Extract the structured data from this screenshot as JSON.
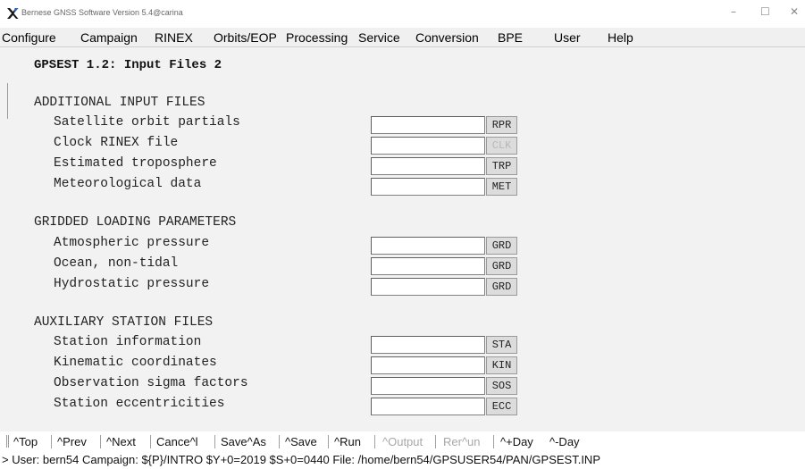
{
  "window": {
    "title": "Bernese GNSS Software Version 5.4@carina",
    "controls": {
      "minimize": "–",
      "maximize": "☐",
      "close": "✕"
    },
    "icon": "bernese-x-icon"
  },
  "menu": [
    "Configure",
    "Campaign",
    "RINEX",
    "Orbits/EOP",
    "Processing",
    "Service",
    "Conversion",
    "BPE",
    "User",
    "Help"
  ],
  "panel": {
    "title": "GPSEST 1.2: Input Files 2",
    "sections": [
      {
        "heading": "ADDITIONAL INPUT FILES",
        "rows": [
          {
            "label": "Satellite orbit partials",
            "value": "",
            "button": "RPR",
            "enabled": true
          },
          {
            "label": "Clock RINEX file",
            "value": "",
            "button": "CLK",
            "enabled": false
          },
          {
            "label": "Estimated troposphere",
            "value": "",
            "button": "TRP",
            "enabled": true
          },
          {
            "label": "Meteorological data",
            "value": "",
            "button": "MET",
            "enabled": true
          }
        ]
      },
      {
        "heading": "GRIDDED LOADING PARAMETERS",
        "rows": [
          {
            "label": "Atmospheric pressure",
            "value": "",
            "button": "GRD",
            "enabled": true
          },
          {
            "label": "Ocean, non-tidal",
            "value": "",
            "button": "GRD",
            "enabled": true
          },
          {
            "label": "Hydrostatic pressure",
            "value": "",
            "button": "GRD",
            "enabled": true
          }
        ]
      },
      {
        "heading": "AUXILIARY STATION FILES",
        "rows": [
          {
            "label": "Station information",
            "value": "",
            "button": "STA",
            "enabled": true
          },
          {
            "label": "Kinematic coordinates",
            "value": "",
            "button": "KIN",
            "enabled": true
          },
          {
            "label": "Observation sigma factors",
            "value": "",
            "button": "SOS",
            "enabled": true
          },
          {
            "label": "Station eccentricities",
            "value": "",
            "button": "ECC",
            "enabled": true
          }
        ]
      }
    ]
  },
  "statusbar": [
    {
      "label": "^Top",
      "enabled": true
    },
    {
      "label": "^Prev",
      "enabled": true
    },
    {
      "label": "^Next",
      "enabled": true
    },
    {
      "label": "Cance^l",
      "enabled": true
    },
    {
      "label": "Save^As",
      "enabled": true
    },
    {
      "label": "^Save",
      "enabled": true
    },
    {
      "label": "^Run",
      "enabled": true
    },
    {
      "label": "^Output",
      "enabled": false
    },
    {
      "label": "Rer^un",
      "enabled": false
    },
    {
      "label": "^+Day",
      "enabled": true
    },
    {
      "label": "^-Day",
      "enabled": true
    }
  ],
  "info": "> User: bern54  Campaign: ${P}/INTRO  $Y+0=2019  $S+0=0440  File: /home/bern54/GPSUSER54/PAN/GPSEST.INP"
}
